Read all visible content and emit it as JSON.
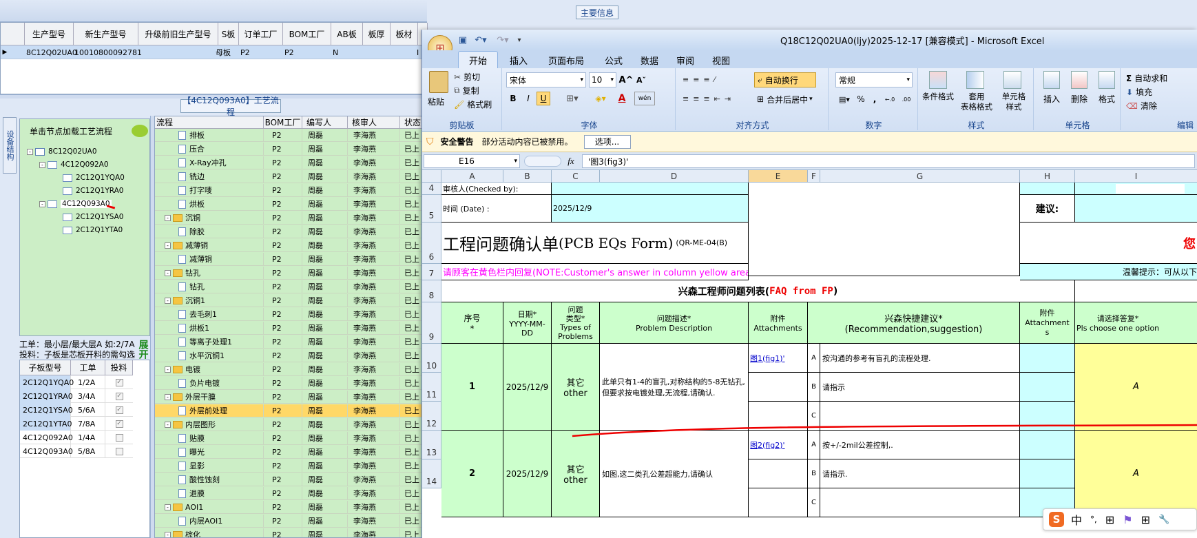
{
  "left": {
    "main_info_title": "主要信息",
    "top_headers": [
      "生产型号",
      "新生产型号",
      "升级前旧生产型号",
      "S板",
      "订单工厂",
      "BOM工厂",
      "AB板",
      "板厚",
      "板材"
    ],
    "top_row": [
      "8C12Q02UA0",
      "10010800092781",
      "",
      "母板",
      "P2",
      "P2",
      "N",
      "",
      ""
    ],
    "top_row_trail": "I",
    "process_title": "【4C12Q093A0】工艺流程",
    "side_tab": "设备结构",
    "tree_hint": "单击节点加载工艺流程",
    "tree": [
      "8C12Q02UA0",
      "4C12Q092A0",
      "2C12Q1YQA0",
      "2C12Q1YRA0",
      "4C12Q093A0",
      "2C12Q1YSA0",
      "2C12Q1YTA0"
    ],
    "note1": "工单：最小层/最大层A 如:2/7A",
    "note2": "投料：子板是芯板开料的需勾选",
    "expand": "展开",
    "sub_headers": [
      "子板型号",
      "工单",
      "投料"
    ],
    "sub_rows": [
      {
        "model": "2C12Q1YQA0",
        "order": "1/2A",
        "checked": true
      },
      {
        "model": "2C12Q1YRA0",
        "order": "3/4A",
        "checked": true
      },
      {
        "model": "2C12Q1YSA0",
        "order": "5/6A",
        "checked": true
      },
      {
        "model": "2C12Q1YTA0",
        "order": "7/8A",
        "checked": true
      },
      {
        "model": "4C12Q092A0",
        "order": "1/4A",
        "checked": false
      },
      {
        "model": "4C12Q093A0",
        "order": "5/8A",
        "checked": false
      }
    ],
    "flow_headers": [
      "流程",
      "BOM工厂",
      "编写人",
      "核审人",
      "状态"
    ],
    "flow_rows": [
      {
        "name": "排板",
        "type": "doc",
        "indent": 2
      },
      {
        "name": "压合",
        "type": "doc",
        "indent": 2
      },
      {
        "name": "X-Ray冲孔",
        "type": "doc",
        "indent": 2
      },
      {
        "name": "铣边",
        "type": "doc",
        "indent": 2
      },
      {
        "name": "打字唛",
        "type": "doc",
        "indent": 2
      },
      {
        "name": "烘板",
        "type": "doc",
        "indent": 2
      },
      {
        "name": "沉铜",
        "type": "folder",
        "indent": 1
      },
      {
        "name": "除胶",
        "type": "doc",
        "indent": 2
      },
      {
        "name": "减薄铜",
        "type": "folder",
        "indent": 1
      },
      {
        "name": "减薄铜",
        "type": "doc",
        "indent": 2
      },
      {
        "name": "钻孔",
        "type": "folder",
        "indent": 1
      },
      {
        "name": "钻孔",
        "type": "doc",
        "indent": 2
      },
      {
        "name": "沉铜1",
        "type": "folder",
        "indent": 1
      },
      {
        "name": "去毛刺1",
        "type": "doc",
        "indent": 2
      },
      {
        "name": "烘板1",
        "type": "doc",
        "indent": 2
      },
      {
        "name": "等离子处理1",
        "type": "doc",
        "indent": 2
      },
      {
        "name": "水平沉铜1",
        "type": "doc",
        "indent": 2
      },
      {
        "name": "电镀",
        "type": "folder",
        "indent": 1
      },
      {
        "name": "负片电镀",
        "type": "doc",
        "indent": 2
      },
      {
        "name": "外层干膜",
        "type": "folder",
        "indent": 1
      },
      {
        "name": "外层前处理",
        "type": "doc",
        "indent": 2,
        "selected": true
      },
      {
        "name": "内层图形",
        "type": "folder",
        "indent": 1
      },
      {
        "name": "贴膜",
        "type": "doc",
        "indent": 2
      },
      {
        "name": "曝光",
        "type": "doc",
        "indent": 2
      },
      {
        "name": "显影",
        "type": "doc",
        "indent": 2
      },
      {
        "name": "酸性蚀刻",
        "type": "doc",
        "indent": 2
      },
      {
        "name": "退膜",
        "type": "doc",
        "indent": 2
      },
      {
        "name": "AOI1",
        "type": "folder",
        "indent": 1
      },
      {
        "name": "内层AOI1",
        "type": "doc",
        "indent": 2
      },
      {
        "name": "棕化",
        "type": "folder",
        "indent": 1
      },
      {
        "name": "棕化",
        "type": "doc",
        "indent": 2
      }
    ],
    "flow_bom": "P2",
    "flow_writer": "周磊",
    "flow_checker": "李海燕",
    "flow_status": "已上"
  },
  "excel": {
    "title": "Q18C12Q02UA0(ljy)2025-12-17  [兼容模式] - Microsoft Excel",
    "tabs": [
      "开始",
      "插入",
      "页面布局",
      "公式",
      "数据",
      "审阅",
      "视图"
    ],
    "clipboard": {
      "paste": "粘贴",
      "cut": "剪切",
      "copy": "复制",
      "format_painter": "格式刷",
      "label": "剪贴板"
    },
    "font": {
      "name": "宋体",
      "size": "10",
      "label": "字体",
      "bold": "B",
      "italic": "I",
      "underline": "U",
      "strike": "A",
      "wen": "wén"
    },
    "align": {
      "wrap": "自动换行",
      "merge": "合并后居中",
      "label": "对齐方式"
    },
    "number": {
      "format": "常规",
      "label": "数字",
      "percent": "%",
      "comma": ",",
      "inc": "←.0",
      "dec": ".00"
    },
    "style": {
      "cond": "条件格式",
      "table1": "套用",
      "table2": "表格格式",
      "cell1": "单元格",
      "cell2": "样式",
      "label": "样式"
    },
    "cells": {
      "insert": "插入",
      "delete": "删除",
      "format": "格式",
      "label": "单元格"
    },
    "edit": {
      "autosum": "自动求和",
      "fill": "填充",
      "clear": "清除",
      "label": "编辑"
    },
    "security": {
      "title": "安全警告",
      "message": "部分活动内容已被禁用。",
      "options": "选项..."
    },
    "namebox": "E16",
    "formula": "'图3(fig3)'",
    "fx": "fx",
    "col_headers": [
      "A",
      "B",
      "C",
      "D",
      "E",
      "F",
      "G",
      "H",
      "I"
    ],
    "rows": [
      "4",
      "5",
      "6",
      "7",
      "8",
      "9",
      "10",
      "11",
      "12",
      "13",
      "14"
    ],
    "checked_by": "审核人(Checked by):",
    "date_label": "时间 (Date) :",
    "date_value": "2025/12/9",
    "suggest": "建议:",
    "form_title": "工程问题确认单",
    "form_title_en": "(PCB EQs Form)",
    "form_code": "(QR-ME-04(B)",
    "red_right": "您",
    "note_magenta": "请顾客在黄色栏内回复(NOTE:Customer's answer in column yellow area)",
    "tip": "温馨提示：可从以下",
    "list_title": "兴森工程师问题列表(",
    "list_title_red": "FAQ from FP",
    "list_title_end": ")",
    "hdr_seq": "序号\n*",
    "hdr_date": "日期*\nYYYY-MM-DD",
    "hdr_type": "问题\n类型*\nTypes of\nProblems",
    "hdr_desc": "问题描述*\nProblem Description",
    "hdr_attach": "附件\nAttachments",
    "hdr_rec": "兴森快捷建议*\n(Recommendation,suggestion)",
    "hdr_attach2": "附件\nAttachment\ns",
    "hdr_choose": "请选择答复*\nPls choose one option",
    "issues": [
      {
        "seq": "1",
        "date": "2025/12/9",
        "type": "其它\nother",
        "desc": "此单只有1-4的盲孔,对称结构的5-8无钻孔,但要求按电镀处理,无流程,请确认.",
        "attach": "图1(fig1)'",
        "opts": [
          {
            "k": "A",
            "v": "按沟通的参考有盲孔的流程处理."
          },
          {
            "k": "B",
            "v": "请指示"
          },
          {
            "k": "C",
            "v": ""
          }
        ],
        "answer": "A"
      },
      {
        "seq": "2",
        "date": "2025/12/9",
        "type": "其它\nother",
        "desc": "如图,这二类孔公差超能力,请确认",
        "attach": "图2(fig2)'",
        "opts": [
          {
            "k": "A",
            "v": "按+/-2mil公差控制,."
          },
          {
            "k": "B",
            "v": "请指示."
          },
          {
            "k": "C",
            "v": ""
          }
        ],
        "answer": "A"
      }
    ]
  },
  "ime": [
    "中",
    "°,",
    "⊞",
    "⚑",
    "⊞",
    "🔧"
  ]
}
